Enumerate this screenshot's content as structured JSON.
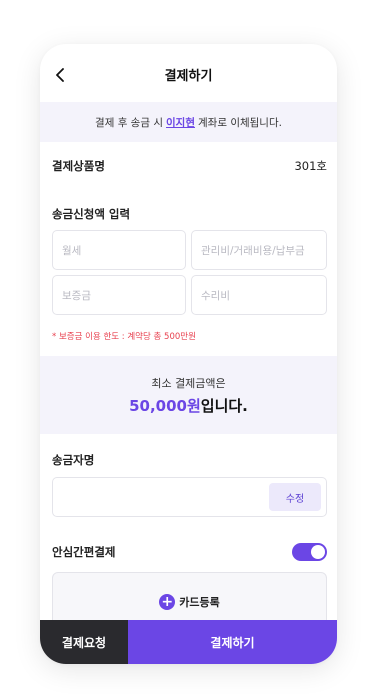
{
  "header": {
    "title": "결제하기",
    "back_icon": "chevron-left-icon"
  },
  "notice": {
    "prefix": "결제 후 송금 시",
    "name": "이지현",
    "suffix": "계좌로 이체됩니다."
  },
  "product": {
    "label": "결제상품명",
    "value": "301호"
  },
  "transfer_request": {
    "label": "송금신청액 입력",
    "fields": {
      "rent": {
        "placeholder": "월세"
      },
      "fees": {
        "placeholder": "관리비/거래비용/납부금"
      },
      "deposit": {
        "placeholder": "보증금"
      },
      "repair": {
        "placeholder": "수리비"
      }
    },
    "limit_note": "* 보증금 이용 한도 : 계약당 총 500만원"
  },
  "minimum": {
    "line1": "최소 결제금액은",
    "amount": "50,000원",
    "suffix": "입니다."
  },
  "sender": {
    "label": "송금자명",
    "value": "",
    "edit_label": "수정"
  },
  "easy_pay": {
    "label": "안심간편결제",
    "enabled": true,
    "accent": "#6b46e5"
  },
  "card": {
    "label": "카드등록",
    "icon": "plus-circle-icon"
  },
  "bottom": {
    "request_label": "결제요청",
    "pay_label": "결제하기"
  }
}
